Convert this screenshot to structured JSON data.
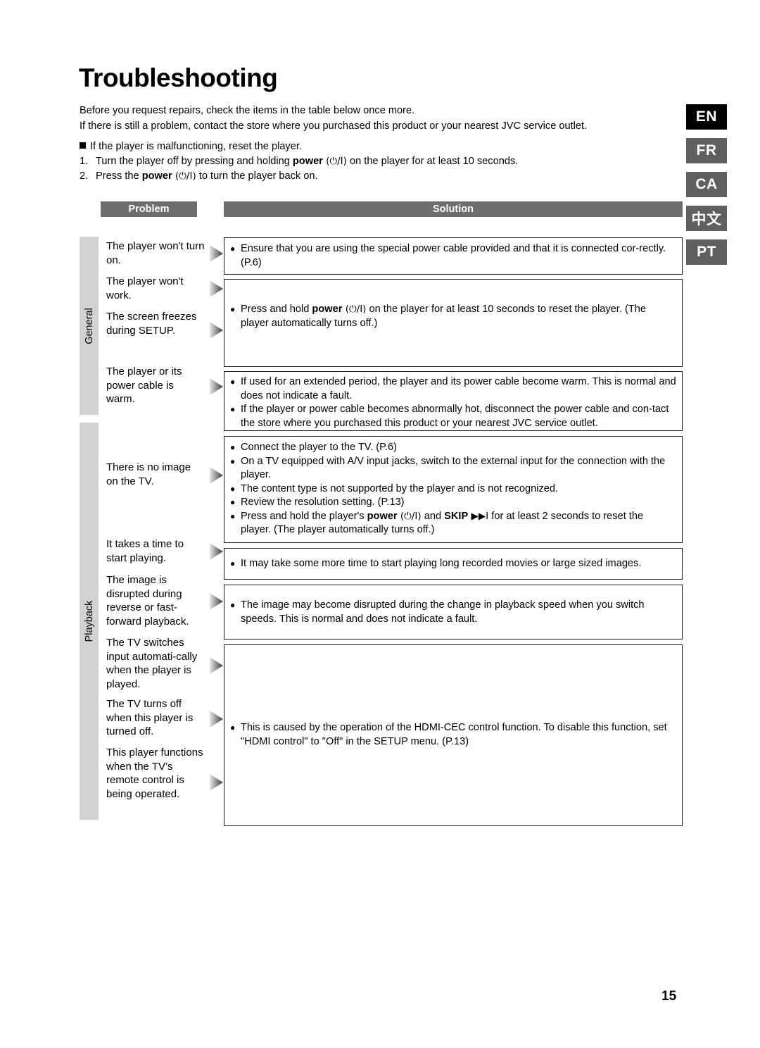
{
  "page": {
    "title": "Troubleshooting",
    "number": "15"
  },
  "intro": {
    "line1": "Before you request repairs, check the items in the table below once more.",
    "line2": "If there is still a problem, contact the store where you purchased this product or your nearest JVC service outlet."
  },
  "reset": {
    "heading": "If the player is malfunctioning, reset the player.",
    "steps": [
      {
        "num": "1.",
        "pre": "Turn the player off by pressing and holding ",
        "bold": "power",
        "symbol": " (⏻/I)",
        "post": " on the player for at least 10 seconds."
      },
      {
        "num": "2.",
        "pre": "Press the ",
        "bold": "power",
        "symbol": " (⏻/I)",
        "post": " to turn the player back on."
      }
    ]
  },
  "language_tabs": [
    {
      "label": "EN",
      "active": true
    },
    {
      "label": "FR",
      "active": false
    },
    {
      "label": "CA",
      "active": false
    },
    {
      "label": "中文",
      "active": false
    },
    {
      "label": "PT",
      "active": false
    }
  ],
  "table": {
    "headers": {
      "problem": "Problem",
      "solution": "Solution"
    },
    "groups": [
      {
        "label": "General"
      },
      {
        "label": "Playback"
      }
    ],
    "problems": [
      {
        "text": "The player won't turn on."
      },
      {
        "text": "The player won't work."
      },
      {
        "text": "The screen freezes during SETUP."
      },
      {
        "text": "The player or its power cable is warm."
      },
      {
        "text": "There is no image on the TV."
      },
      {
        "text": "It takes a time to start playing."
      },
      {
        "text": "The image is disrupted during reverse or fast-forward playback."
      },
      {
        "text": "The TV switches input automati-cally when the player is played."
      },
      {
        "text": "The TV turns off when this player is turned off."
      },
      {
        "text": "This player functions when the TV’s remote control is being operated."
      }
    ],
    "solutions": [
      {
        "bullets": [
          {
            "text": "Ensure that you are using the special power cable provided and that it is connected cor-rectly. (P.6)"
          }
        ]
      },
      {
        "bullets": [
          {
            "pre": "Press and hold ",
            "bold": "power",
            "symbol": " (⏻/I)",
            "post": " on the player for at least 10 seconds to reset the player. (The player automatically turns off.)"
          }
        ]
      },
      {
        "bullets": [
          {
            "text": "If used for an extended period, the player and its power cable become warm. This is normal and does not indicate a fault."
          },
          {
            "text": "If the player or power cable becomes abnormally hot, disconnect the power cable and con-tact the store where you purchased this product or your nearest JVC service outlet."
          }
        ]
      },
      {
        "bullets": [
          {
            "text": "Connect the player to the TV. (P.6)"
          },
          {
            "text": "On a TV equipped with A/V input jacks, switch to the external input for the connection with the player."
          },
          {
            "text": "The content type is not supported by the player and is not recognized."
          },
          {
            "text": "Review the resolution setting. (P.13)"
          },
          {
            "pre": "Press and hold the player's ",
            "bold": "power",
            "symbol": " (⏻/I)",
            "mid": " and ",
            "bold2": "SKIP",
            "symbol2": " ▶▶I",
            "post": " for at least 2 seconds to reset the player. (The player automatically turns off.)"
          }
        ]
      },
      {
        "bullets": [
          {
            "text": "It may take some more time to start playing long recorded movies or large sized images."
          }
        ]
      },
      {
        "bullets": [
          {
            "text": "The image may become disrupted during the change in playback speed when you switch speeds.  This is normal and does not indicate a fault."
          }
        ]
      },
      {
        "bullets": [
          {
            "text": "This is caused by the operation of the HDMI-CEC control function. To disable this function, set \"HDMI control\" to \"Off\" in the SETUP menu. (P.13)"
          }
        ]
      }
    ]
  },
  "colors": {
    "header_bar": "#6e6e6e",
    "group_bar": "#d2d2d2",
    "tab_inactive": "#5f5f5f",
    "tab_active": "#000000"
  }
}
